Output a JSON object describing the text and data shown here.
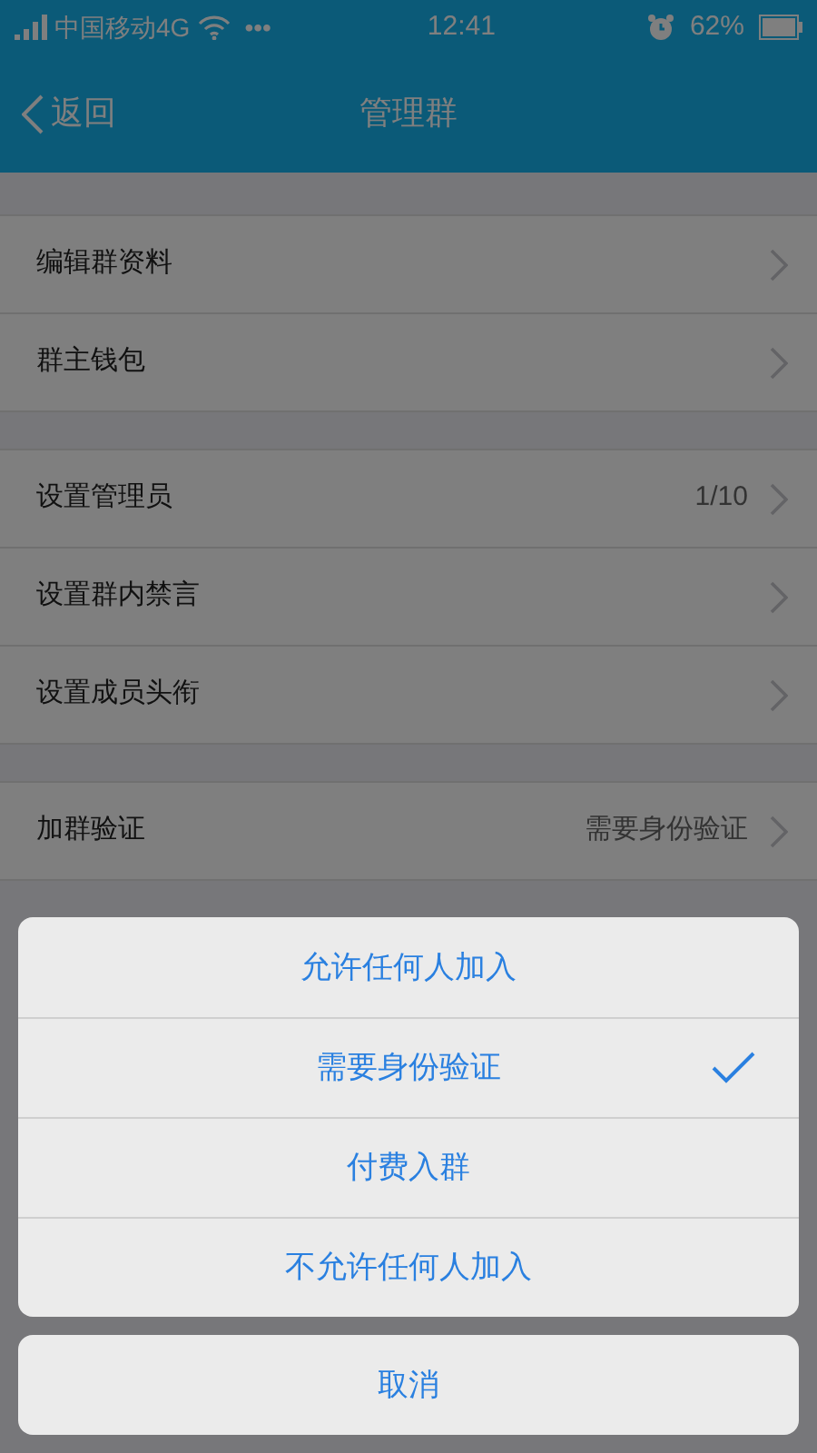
{
  "status_bar": {
    "carrier": "中国移动4G",
    "dots": "•••",
    "time": "12:41",
    "battery": "62%"
  },
  "nav": {
    "back": "返回",
    "title": "管理群"
  },
  "groups": [
    [
      {
        "kind": "link",
        "label": "编辑群资料"
      },
      {
        "kind": "link",
        "label": "群主钱包"
      }
    ],
    [
      {
        "kind": "link",
        "label": "设置管理员",
        "value": "1/10"
      },
      {
        "kind": "link",
        "label": "设置群内禁言"
      },
      {
        "kind": "link",
        "label": "设置成员头衔"
      }
    ],
    [
      {
        "kind": "link",
        "label": "加群验证",
        "value": "需要身份验证"
      }
    ]
  ],
  "action_sheet": {
    "options": [
      {
        "label": "允许任何人加入",
        "selected": false
      },
      {
        "label": "需要身份验证",
        "selected": true
      },
      {
        "label": "付费入群",
        "selected": false
      },
      {
        "label": "不允许任何人加入",
        "selected": false
      }
    ],
    "cancel": "取消"
  }
}
